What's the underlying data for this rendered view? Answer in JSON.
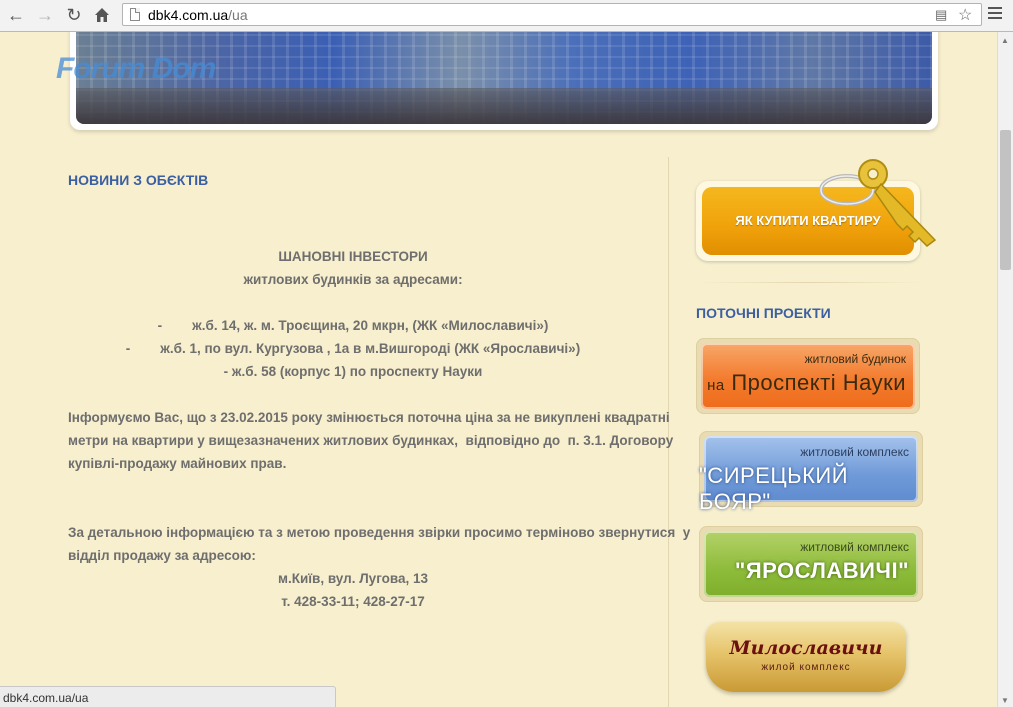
{
  "browser": {
    "url_host": "dbk4.com.ua",
    "url_path": "/ua",
    "status_url": "dbk4.com.ua/ua",
    "icons": [
      "back-icon",
      "forward-icon",
      "reload-icon",
      "home-icon",
      "translate-icon",
      "star-icon",
      "menu-icon"
    ]
  },
  "header": {
    "logo_text": "Forum Dom"
  },
  "news": {
    "title": "НОВИНИ З ОБЄКТІВ",
    "greeting_1": "ШАНОВНІ ІНВЕСТОРИ",
    "greeting_2": "житлових будинків за адресами:",
    "addresses": [
      "-        ж.б. 14, ж. м. Троєщина, 20 мкрн, (ЖК «Милославичі»)",
      "-        ж.б. 1, по вул. Кургузова , 1а в м.Вишгороді (ЖК «Ярославичі»)",
      "- ж.б. 58 (корпус 1) по проспекту Науки"
    ],
    "paragraph_1": [
      "Інформуємо Вас, що з 23.02.2015 року змінюється поточна ціна за не викуплені квадратні",
      "метри на квартири у вищезазначених житлових будинках,  відповідно до  п. 3.1. Договору",
      "купівлі-продажу майнових прав."
    ],
    "paragraph_2": [
      "За детальною інформацією та з метою проведення звірки просимо терміново звернутися  у",
      "відділ продажу за адресою:"
    ],
    "address_line": "м.Київ, вул. Лугова, 13",
    "phone_line": "т. 428-33-11; 428-27-17"
  },
  "sidebar": {
    "buy_button": "ЯК КУПИТИ КВАРТИРУ",
    "projects_title": "ПОТОЧНІ ПРОЕКТИ",
    "projects": [
      {
        "small": "житловий будинок",
        "prefix": "на",
        "big": "Проспекті Науки"
      },
      {
        "small": "житловий комплекс",
        "big": "\"СИРЕЦЬКИЙ БОЯР\""
      },
      {
        "small": "житловий комплекс",
        "big": "\"ЯРОСЛАВИЧІ\""
      }
    ],
    "milo_title": "Милославичи",
    "milo_sub": "жилой комплекс"
  }
}
